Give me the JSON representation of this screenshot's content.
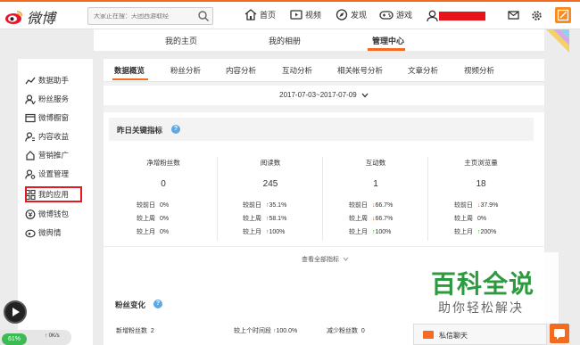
{
  "topbar": {
    "logo_text": "微博",
    "search_placeholder": "大家正在搜：天团西游取经",
    "nav": [
      {
        "label": "首页",
        "icon": "home-icon"
      },
      {
        "label": "视频",
        "icon": "video-icon"
      },
      {
        "label": "发现",
        "icon": "compass-icon"
      },
      {
        "label": "游戏",
        "icon": "gamepad-icon"
      }
    ],
    "right_icons": [
      "mail-icon",
      "gear-icon",
      "write-icon"
    ]
  },
  "subnav": {
    "items": [
      "我的主页",
      "我的相册",
      "管理中心"
    ],
    "active": "管理中心"
  },
  "sidebar": {
    "items": [
      {
        "label": "数据助手",
        "icon": "chart-icon"
      },
      {
        "label": "粉丝服务",
        "icon": "fans-icon"
      },
      {
        "label": "微博橱窗",
        "icon": "shop-icon"
      },
      {
        "label": "内容收益",
        "icon": "income-icon"
      },
      {
        "label": "营销推广",
        "icon": "marketing-icon"
      },
      {
        "label": "设置管理",
        "icon": "settings-user-icon"
      },
      {
        "label": "我的应用",
        "icon": "apps-grid-icon"
      },
      {
        "label": "微博钱包",
        "icon": "wallet-icon"
      },
      {
        "label": "微舆情",
        "icon": "sentiment-icon"
      }
    ],
    "highlighted": "我的应用"
  },
  "tabs": {
    "items": [
      "数据概览",
      "粉丝分析",
      "内容分析",
      "互动分析",
      "相关帐号分析",
      "文章分析",
      "视频分析"
    ],
    "active": "数据概览"
  },
  "date_range": "2017-07-03~2017-07-09",
  "yesterday": {
    "title": "昨日关键指标",
    "help": "?",
    "metrics": [
      {
        "label": "净增粉丝数",
        "value": "0",
        "compare": [
          {
            "label": "较前日",
            "value": "0%",
            "dir": ""
          },
          {
            "label": "较上周",
            "value": "0%",
            "dir": ""
          },
          {
            "label": "较上月",
            "value": "0%",
            "dir": ""
          }
        ]
      },
      {
        "label": "阅读数",
        "value": "245",
        "compare": [
          {
            "label": "较前日",
            "value": "35.1%",
            "dir": "up"
          },
          {
            "label": "较上周",
            "value": "58.1%",
            "dir": "up"
          },
          {
            "label": "较上月",
            "value": "100%",
            "dir": "up"
          }
        ]
      },
      {
        "label": "互动数",
        "value": "1",
        "compare": [
          {
            "label": "较前日",
            "value": "66.7%",
            "dir": "down"
          },
          {
            "label": "较上周",
            "value": "66.7%",
            "dir": "down"
          },
          {
            "label": "较上月",
            "value": "100%",
            "dir": "up"
          }
        ]
      },
      {
        "label": "主页浏览量",
        "value": "18",
        "compare": [
          {
            "label": "较前日",
            "value": "37.9%",
            "dir": "down"
          },
          {
            "label": "较上周",
            "value": "0%",
            "dir": ""
          },
          {
            "label": "较上月",
            "value": "200%",
            "dir": "up"
          }
        ]
      }
    ],
    "view_all": "查看全部指标"
  },
  "fans": {
    "title": "粉丝变化",
    "help": "?",
    "row": [
      {
        "label": "新增粉丝数",
        "value": "2"
      },
      {
        "label": "较上个时间段",
        "value": "100.0%",
        "dir": "up"
      },
      {
        "label": "减少粉丝数",
        "value": "0"
      }
    ]
  },
  "watermark": {
    "big": "百科全说",
    "small": "助你轻松解决"
  },
  "chat": {
    "label": "私信聊天"
  },
  "overlay": {
    "speed_percent": "61%",
    "speed_up": "0K/s",
    "speed_down": "0K/s"
  }
}
